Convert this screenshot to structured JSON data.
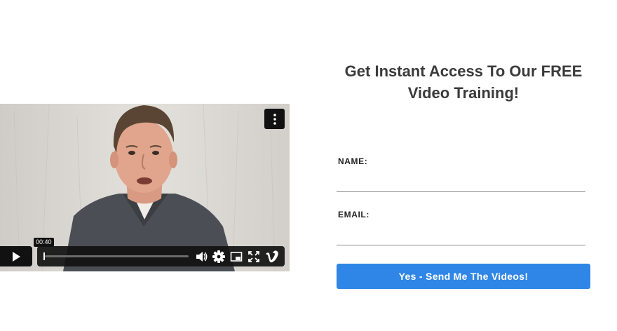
{
  "video": {
    "timestamp": "00:40",
    "progress_fraction": 0.0,
    "icons": {
      "more": "more-vertical-icon",
      "play": "play-icon",
      "volume": "volume-icon",
      "settings": "gear-icon",
      "pip": "picture-in-picture-icon",
      "fullscreen": "fullscreen-icon",
      "brand": "vimeo-logo-icon"
    }
  },
  "form": {
    "headline": "Get Instant Access To Our FREE Video Training!",
    "name_label": "NAME:",
    "email_label": "EMAIL:",
    "name_value": "",
    "email_value": "",
    "submit_label": "Yes - Send Me The Videos!",
    "accent_color": "#2f86e6"
  }
}
